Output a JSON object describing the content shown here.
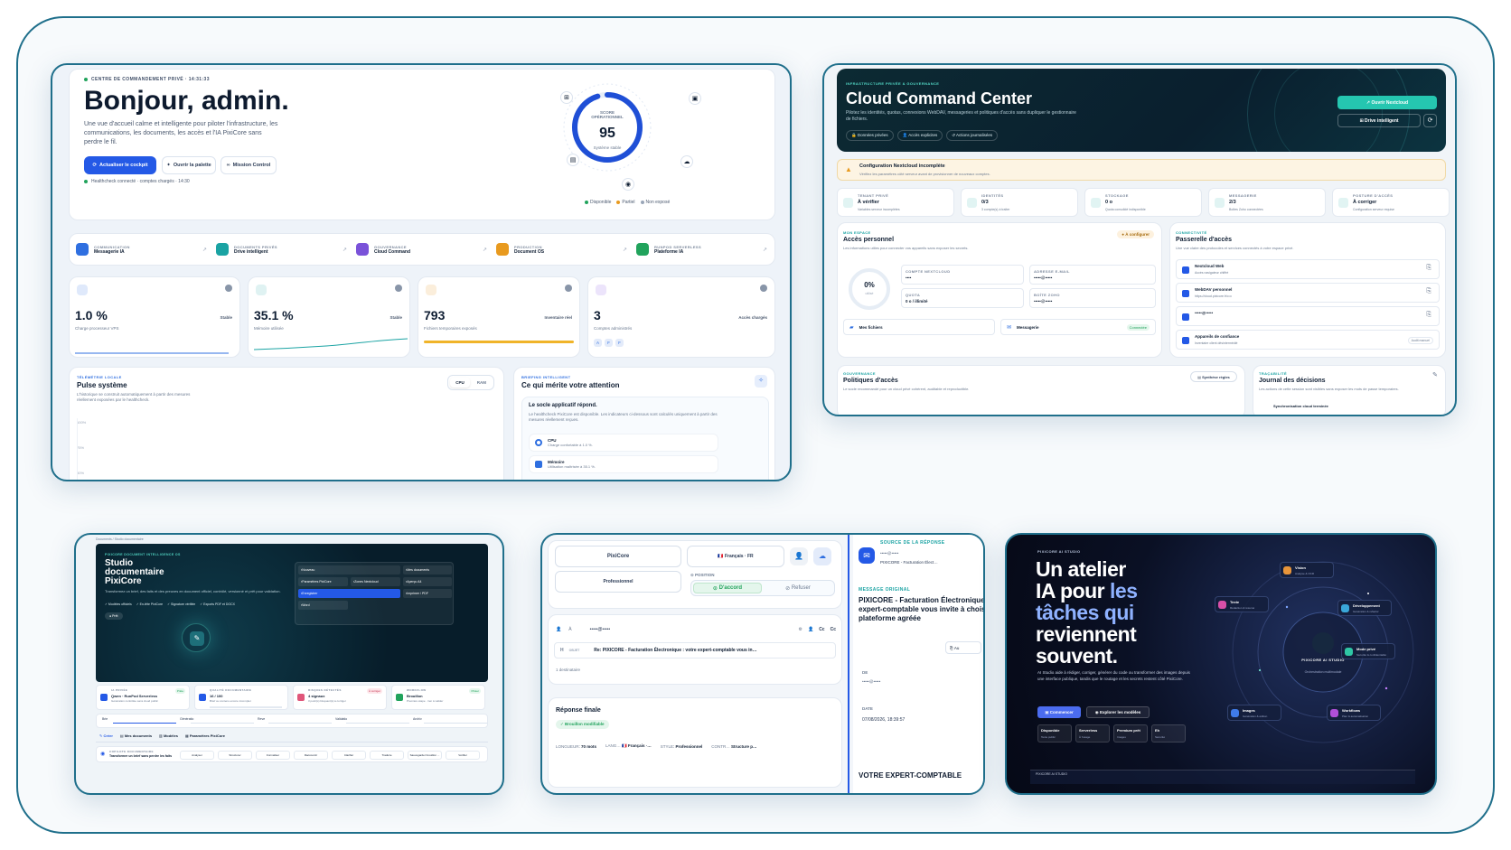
{
  "w1": {
    "kicker": "CENTRE DE COMMANDEMENT PRIVÉ",
    "time": "14:31:33",
    "greeting": "Bonjour, admin.",
    "intro": "Une vue d'accueil calme et intelligente pour piloter l'infrastructure, les communications, les documents, les accès et l'IA PixiCore sans perdre le fil.",
    "btn_refresh": "Actualiser le cockpit",
    "btn_palette": "Ouvrir la palette",
    "btn_mission": "Mission Control",
    "health": "Healthcheck connecté · comptes chargés · 14:30",
    "score_label": "SCORE OPÉRATIONNEL",
    "score": "95",
    "score_sub": "Système stable",
    "legend": [
      "Disponible",
      "Partiel",
      "Non exposé"
    ],
    "modules": [
      {
        "cat": "COMMUNICATION",
        "name": "Messagerie IA",
        "color": "#2f6fe0"
      },
      {
        "cat": "DOCUMENTS PRIVÉS",
        "name": "Drive intelligent",
        "color": "#1aa3a3"
      },
      {
        "cat": "GOUVERNANCE",
        "name": "Cloud Command",
        "color": "#7a52d9"
      },
      {
        "cat": "PRODUCTION",
        "name": "Document OS",
        "color": "#e89a1f"
      },
      {
        "cat": "RUNPOD SERVERLESS",
        "name": "Plateforme IA",
        "color": "#21a35c"
      }
    ],
    "stats": [
      {
        "value": "1.0 %",
        "tag": "Stable",
        "label": "Charge processeur VPS",
        "color": "#2f6fe0"
      },
      {
        "value": "35.1 %",
        "tag": "Stable",
        "label": "Mémoire utilisée",
        "color": "#1aa3a3"
      },
      {
        "value": "793",
        "tag": "Inventaire réel",
        "label": "Fichiers temporaires exposés",
        "color": "#e89a1f"
      },
      {
        "value": "3",
        "tag": "Accès chargés",
        "label": "Comptes administrés",
        "color": "#7a52d9"
      }
    ],
    "avatars": [
      "A",
      "F",
      "F"
    ],
    "tele_kicker": "TÉLÉMÉTRIE LOCALE",
    "tele_title": "Pulse système",
    "tele_desc": "L'historique se construit automatiquement à partir des mesures réellement exposées par le healthcheck.",
    "tabs": [
      "CPU",
      "RAM"
    ],
    "ticks": [
      "100%",
      "75%",
      "50%"
    ],
    "brief_kicker": "BRIEFING INTELLIGENT",
    "brief_title": "Ce qui mérite votre attention",
    "brief_head": "Le socle applicatif répond.",
    "brief_text": "Le healthcheck PixiCore est disponible. Les indicateurs ci-dessous sont calculés uniquement à partir des mesures réellement reçues.",
    "brief_items": [
      {
        "t": "CPU",
        "d": "Charge confortable à 1.0 %."
      },
      {
        "t": "Mémoire",
        "d": "Utilisation maîtrisée à 35.1 %."
      }
    ]
  },
  "w2": {
    "kicker": "INFRASTRUCTURE PRIVÉE & GOUVERNANCE",
    "title": "Cloud Command Center",
    "desc": "Pilotez les identités, quotas, connexions WebDAV, messageries et politiques d'accès sans dupliquer le gestionnaire de fichiers.",
    "chips": [
      "Données privées",
      "Accès explicites",
      "Actions journalisées"
    ],
    "btn_open": "Ouvrir Nextcloud",
    "btn_drive": "Drive intelligent",
    "warn_title": "Configuration Nextcloud incomplète",
    "warn_text": "Vérifiez les paramètres côté serveur avant de provisionner de nouveaux comptes.",
    "stats": [
      {
        "cat": "TENANT PRIVÉ",
        "val": "À vérifier",
        "sub": "Variables serveur incomplètes"
      },
      {
        "cat": "IDENTITÉS",
        "val": "0/3",
        "sub": "3 compte(s) à traiter"
      },
      {
        "cat": "STOCKAGE",
        "val": "0 o",
        "sub": "Quota consolidé indisponible"
      },
      {
        "cat": "MESSAGERIE",
        "val": "2/3",
        "sub": "Boîtes Zoho connectées"
      },
      {
        "cat": "POSTURE D'ACCÈS",
        "val": "À corriger",
        "sub": "Configuration serveur requise"
      }
    ],
    "space_kicker": "MON ESPACE",
    "space_title": "Accès personnel",
    "space_desc": "Les informations utiles pour connecter vos appareils sans exposer les secrets.",
    "space_badge": "À configurer",
    "gauge": "0%",
    "gauge_sub": "utilisé",
    "fields": [
      {
        "l": "COMPTE NEXTCLOUD",
        "v": "••••"
      },
      {
        "l": "ADRESSE E-MAIL",
        "v": "•••••@•••••"
      },
      {
        "l": "QUOTA",
        "v": "0 o / illimité"
      },
      {
        "l": "BOÎTE ZOHO",
        "v": "•••••@•••••"
      }
    ],
    "links": [
      {
        "t": "Mes fichiers"
      },
      {
        "t": "Messagerie",
        "b": "Connectée"
      }
    ],
    "gw_kicker": "CONNECTIVITÉ",
    "gw_title": "Passerelle d'accès",
    "gw_desc": "Une vue claire des protocoles et services connectés à votre espace privé.",
    "gw_items": [
      {
        "t": "Nextcloud Web",
        "d": "Accès navigateur chiffré"
      },
      {
        "t": "WebDAV personnel",
        "d": "https://cloud.pixicore.fr/••••"
      },
      {
        "t": "•••••@•••••",
        "d": ""
      },
      {
        "t": "Appareils de confiance",
        "d": "Inventaire client désintermédié",
        "b": "Audit manuel"
      }
    ],
    "gov_kicker": "GOUVERNANCE",
    "gov_title": "Politiques d'accès",
    "gov_desc": "Le socle recommandé pour un cloud privé cohérent, auditable et reproductible.",
    "gov_btn": "Synthèse règles",
    "trace_kicker": "TRAÇABILITÉ",
    "trace_title": "Journal des décisions",
    "trace_desc": "Les actions de cette session sont visibles sans exposer les mots de passe temporaires.",
    "trace_item": "Synchronisation cloud terminée"
  },
  "w3": {
    "breadcrumb": "Documents / Studio documentaire",
    "kicker": "PIXICORE DOCUMENT INTELLIGENCE OS",
    "title": "Studio documentaire PixiCore",
    "desc": "Transformez un brief, des faits et des preuves en document officiel, contrôlé, versionné et prêt pour validation.",
    "chips": [
      "Modèles officiels",
      "En-tête PixiCore",
      "Signature vérifiée",
      "Exports PDF et DOCX"
    ],
    "status": "Prêt",
    "menu": [
      "Nouveau",
      "Mes documents",
      "Paramètres PixiCore",
      "Zones Nextcloud",
      "Aperçu A4",
      "Enregistrer",
      "Imprimer / PDF",
      "Word"
    ],
    "cards": [
      {
        "c": "IA PRIVÉE",
        "t": "Qwen · RunPod Serverless",
        "d": "Génération contrôlée sans cloud public",
        "b": "Prête"
      },
      {
        "c": "QUALITÉ DOCUMENTAIRE",
        "t": "16 / 100",
        "d": "Brief ou contenu encore incomplet",
        "b": ""
      },
      {
        "c": "RISQUES DÉTECTÉS",
        "t": "4 signaux",
        "d": "3 point(s) bloquant(s) à corriger",
        "b": "À corriger"
      },
      {
        "c": "WORKFLOW",
        "t": "Brouillon",
        "d": "Première étape · rien à valider",
        "b": "Piloter"
      }
    ],
    "steps": [
      "Brie",
      "Génératio",
      "Reve",
      "Validatio",
      "Archiv"
    ],
    "tabs": [
      "Créer",
      "Mes documents",
      "Modèles",
      "Paramètres PixiCore"
    ],
    "bottom_kicker": "COPILOTE DOCUMENTAIRE",
    "bottom_title": "Transformer un brief sans perdre les faits",
    "actions": [
      "Analyser",
      "Structurer",
      "Formaliser",
      "Raccourcir",
      "Clarifier",
      "Traduire",
      "Sauvegarder brouillon ...",
      "Vérifier"
    ]
  },
  "w4": {
    "brand": "PixiCore",
    "lang": "🇫🇷 Français · FR",
    "tone": "Professionnel",
    "pos_label": "POSITION",
    "agree": "D'accord",
    "refuse": "Refuser",
    "to_label": "À",
    "to_value": "•••••@•••••",
    "subj_label": "OBJET",
    "subject": "Re: PIXICORE - Facturation Électronique : votre expert-comptable vous in…",
    "recip": "1 destinataire",
    "cc1": "Cc",
    "cc2": "Cc",
    "final_title": "Réponse finale",
    "final_badge": "Brouillon modifiable",
    "meta": [
      {
        "l": "LONGUEUR",
        "v": "70 mots"
      },
      {
        "l": "LANG…",
        "v": "🇫🇷 Français ·…"
      },
      {
        "l": "STYLE",
        "v": "Professionnel"
      },
      {
        "l": "CONTR…",
        "v": "Structure p…"
      }
    ],
    "src_kicker": "SOURCE DE LA RÉPONSE",
    "src_from": "•••••@•••••",
    "src_subject": "PIXICORE - Facturation Élect…",
    "orig_kicker": "MESSAGE ORIGINAL",
    "orig_title": "PIXICORE - Facturation Électronique : votre expert-comptable vous invite à choisir votre plateforme agréée",
    "orig_btn": "Au",
    "de_label": "DE",
    "de_value": "•••••@•••••",
    "date_label": "DATE",
    "date_value": "07/08/2026, 18:39:57",
    "bottom": "VOTRE EXPERT-COMPTABLE"
  },
  "w5": {
    "kicker": "PIXICORE AI STUDIO",
    "title_1": "Un atelier",
    "title_2a": "IA pour",
    "title_2b": " les",
    "title_3": "tâches qui",
    "title_4": "reviennent",
    "title_5": "souvent.",
    "desc": "AI Studio aide à rédiger, corriger, générer du code ou transformer des images depuis une interface publique, tandis que le routage et les secrets restent côté PixiCore.",
    "btn_start": "Commencer",
    "btn_explore": "Explorer les modèles",
    "stats": [
      {
        "t": "Disponible",
        "d": "Texte public"
      },
      {
        "t": "Serverless",
        "d": "À l'usage"
      },
      {
        "t": "Premium prêt",
        "d": "Images"
      },
      {
        "t": "Eh",
        "d": "Sécurité"
      }
    ],
    "orbit_center": "PIXICORE AI STUDIO",
    "orbit_center_sub": "Orchestration multimodale",
    "orbit": [
      {
        "t": "Vision",
        "d": "Analyse & OCR",
        "c": "#e8953a"
      },
      {
        "t": "Texte",
        "d": "Rédaction & résumé",
        "c": "#d94fa8"
      },
      {
        "t": "Développement",
        "d": "Génération & refactor",
        "c": "#3aa7d9"
      },
      {
        "t": "Mode privé",
        "d": "Sécurité & confidentialité",
        "c": "#2fc6a5"
      },
      {
        "t": "Images",
        "d": "Génération & édition",
        "c": "#3f7be8"
      },
      {
        "t": "Workflows",
        "d": "Plan & automatisation",
        "c": "#b04fd9"
      }
    ],
    "footer": "PIXICORE AI STUDIO"
  }
}
